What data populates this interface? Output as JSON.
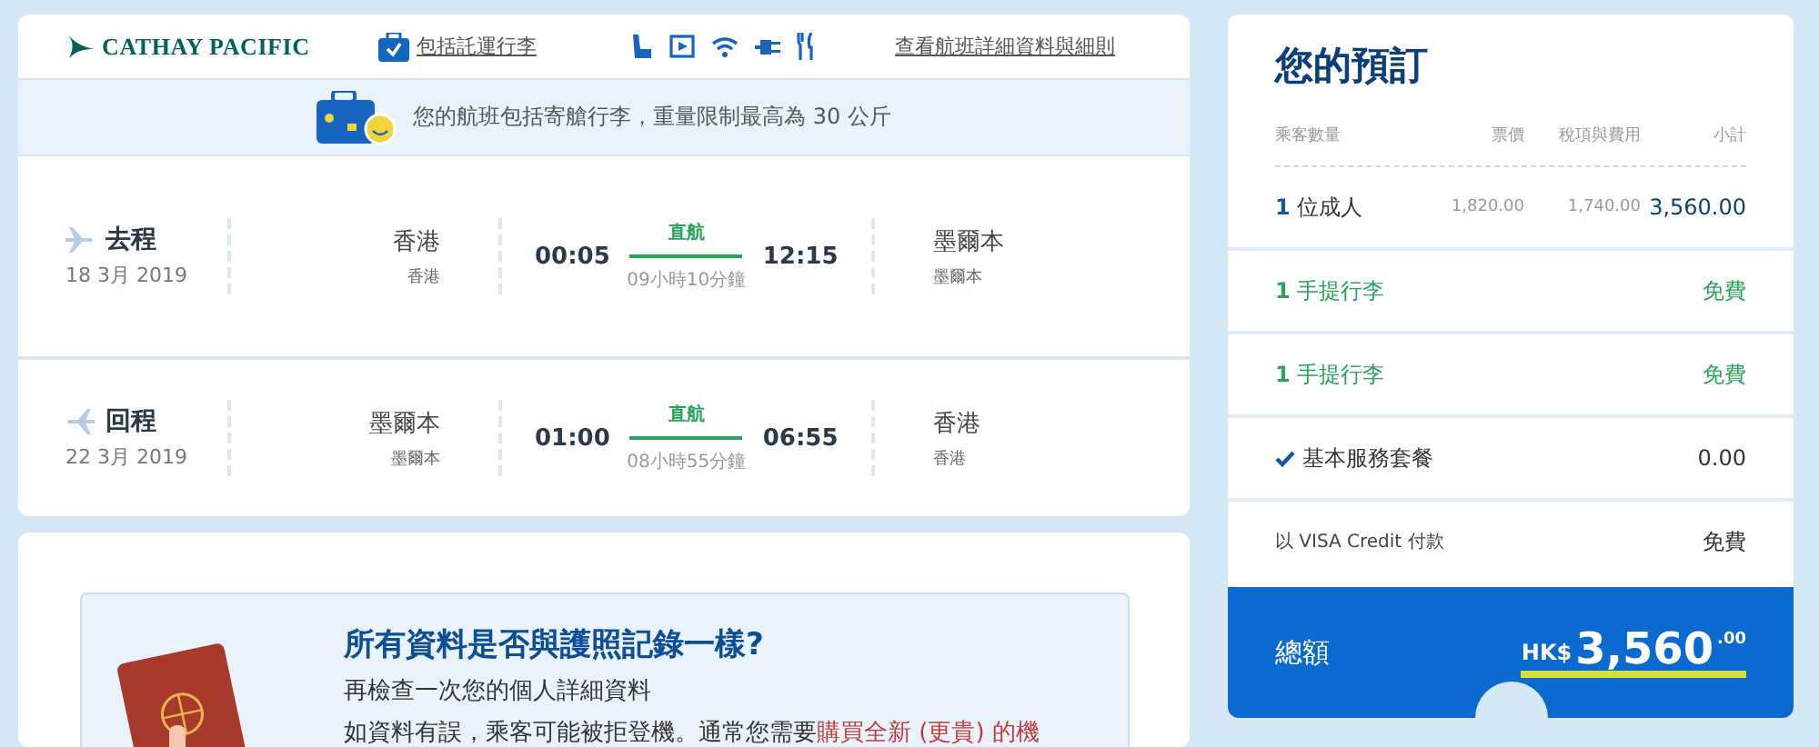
{
  "header": {
    "logo": "CATHAY PACIFIC",
    "baggage_link": "包括託運行李",
    "details_link": "查看航班詳細資料與細則"
  },
  "banner": {
    "text": "您的航班包括寄艙行李，重量限制最高為 30 公斤"
  },
  "flights": [
    {
      "label": "去程",
      "date": "18 3月 2019",
      "origin_city": "香港",
      "origin_sub": "香港",
      "departure": "00:05",
      "stops": "直航",
      "duration": "09小時10分鐘",
      "arrival": "12:15",
      "dest_city": "墨爾本",
      "dest_sub": "墨爾本",
      "kind": "outbound"
    },
    {
      "label": "回程",
      "date": "22 3月 2019",
      "origin_city": "墨爾本",
      "origin_sub": "墨爾本",
      "departure": "01:00",
      "stops": "直航",
      "duration": "08小時55分鐘",
      "arrival": "06:55",
      "dest_city": "香港",
      "dest_sub": "香港",
      "kind": "return"
    }
  ],
  "notice": {
    "title": "所有資料是否與護照記錄一樣?",
    "line1": "再檢查一次您的個人詳細資料",
    "line2": "如資料有誤，乘客可能被拒登機。通常您需要",
    "link": "購買全新 (更貴) 的機"
  },
  "booking": {
    "title": "您的預訂",
    "columns": [
      "乘客數量",
      "票價",
      "稅項與費用",
      "小計"
    ],
    "passenger": {
      "count": "1",
      "label": "位成人",
      "fare": "1,820.00",
      "taxes": "1,740.00",
      "subtotal": "3,560.00"
    },
    "items": [
      {
        "kind": "baggage",
        "count": "1",
        "label": "手提行李",
        "price": "免費"
      },
      {
        "kind": "baggage",
        "count": "1",
        "label": "手提行李",
        "price": "免費"
      },
      {
        "kind": "package",
        "label": "基本服務套餐",
        "price": "0.00",
        "checked": true
      },
      {
        "kind": "payment",
        "label": "以 VISA Credit 付款",
        "price": "免費"
      }
    ],
    "total": {
      "label": "總額",
      "currency": "HK$",
      "amount": "3,560",
      "cents": ".00"
    }
  }
}
